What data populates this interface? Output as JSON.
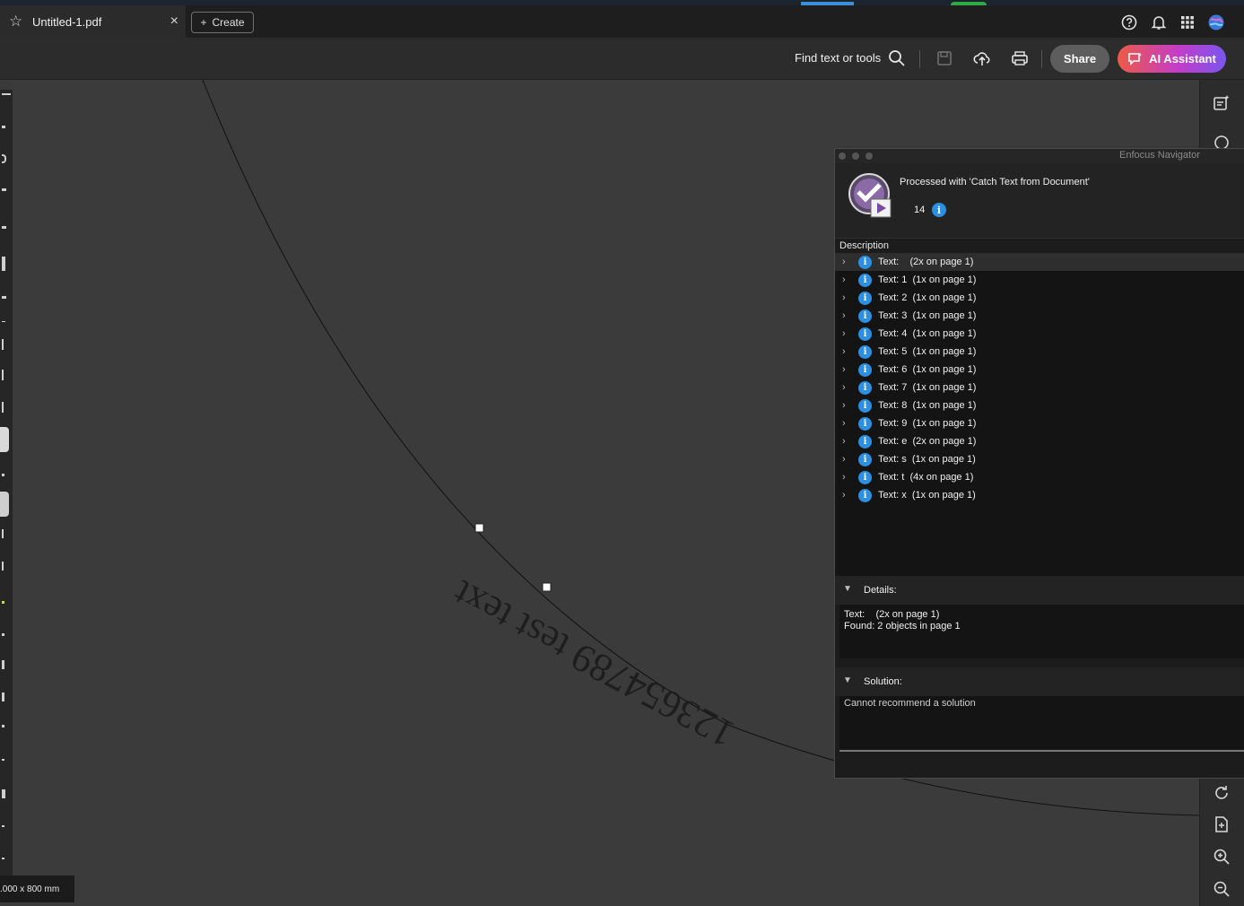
{
  "tab": {
    "title": "Untitled-1.pdf",
    "close": "×",
    "create_label": "Create",
    "create_plus": "+"
  },
  "toolbar": {
    "find_label": "Find text or tools",
    "share_label": "Share",
    "ai_label": "AI Assistant"
  },
  "page_size_label": ".000 x 800 mm",
  "document": {
    "curved_text": "123654789 test text"
  },
  "navigator": {
    "title": "Enfocus Navigator",
    "processed_text": "Processed with 'Catch Text from Document'",
    "count": "14",
    "description_label": "Description",
    "items": [
      {
        "label": "Text:    (2x on page 1)"
      },
      {
        "label": "Text: 1  (1x on page 1)"
      },
      {
        "label": "Text: 2  (1x on page 1)"
      },
      {
        "label": "Text: 3  (1x on page 1)"
      },
      {
        "label": "Text: 4  (1x on page 1)"
      },
      {
        "label": "Text: 5  (1x on page 1)"
      },
      {
        "label": "Text: 6  (1x on page 1)"
      },
      {
        "label": "Text: 7  (1x on page 1)"
      },
      {
        "label": "Text: 8  (1x on page 1)"
      },
      {
        "label": "Text: 9  (1x on page 1)"
      },
      {
        "label": "Text: e  (2x on page 1)"
      },
      {
        "label": "Text: s  (1x on page 1)"
      },
      {
        "label": "Text: t  (4x on page 1)"
      },
      {
        "label": "Text: x  (1x on page 1)"
      }
    ],
    "details_label": "Details:",
    "details_text": "Text:    (2x on page 1)\nFound: 2 objects in page 1",
    "solution_label": "Solution:",
    "solution_text": "Cannot recommend a solution"
  },
  "icons": {
    "tab_star": "star-icon",
    "help": "help-icon",
    "bell": "bell-icon",
    "apps": "apps-grid-icon",
    "avatar": "avatar-icon",
    "search": "search-icon",
    "save": "save-icon",
    "upload": "cloud-upload-icon",
    "print": "print-icon",
    "info": "info-icon",
    "chevron": "chevron-right-icon"
  },
  "colors": {
    "accent_blue": "#2d8fe0",
    "ai_gradient_start": "#ec5a46",
    "ai_gradient_end": "#7a55ef"
  }
}
